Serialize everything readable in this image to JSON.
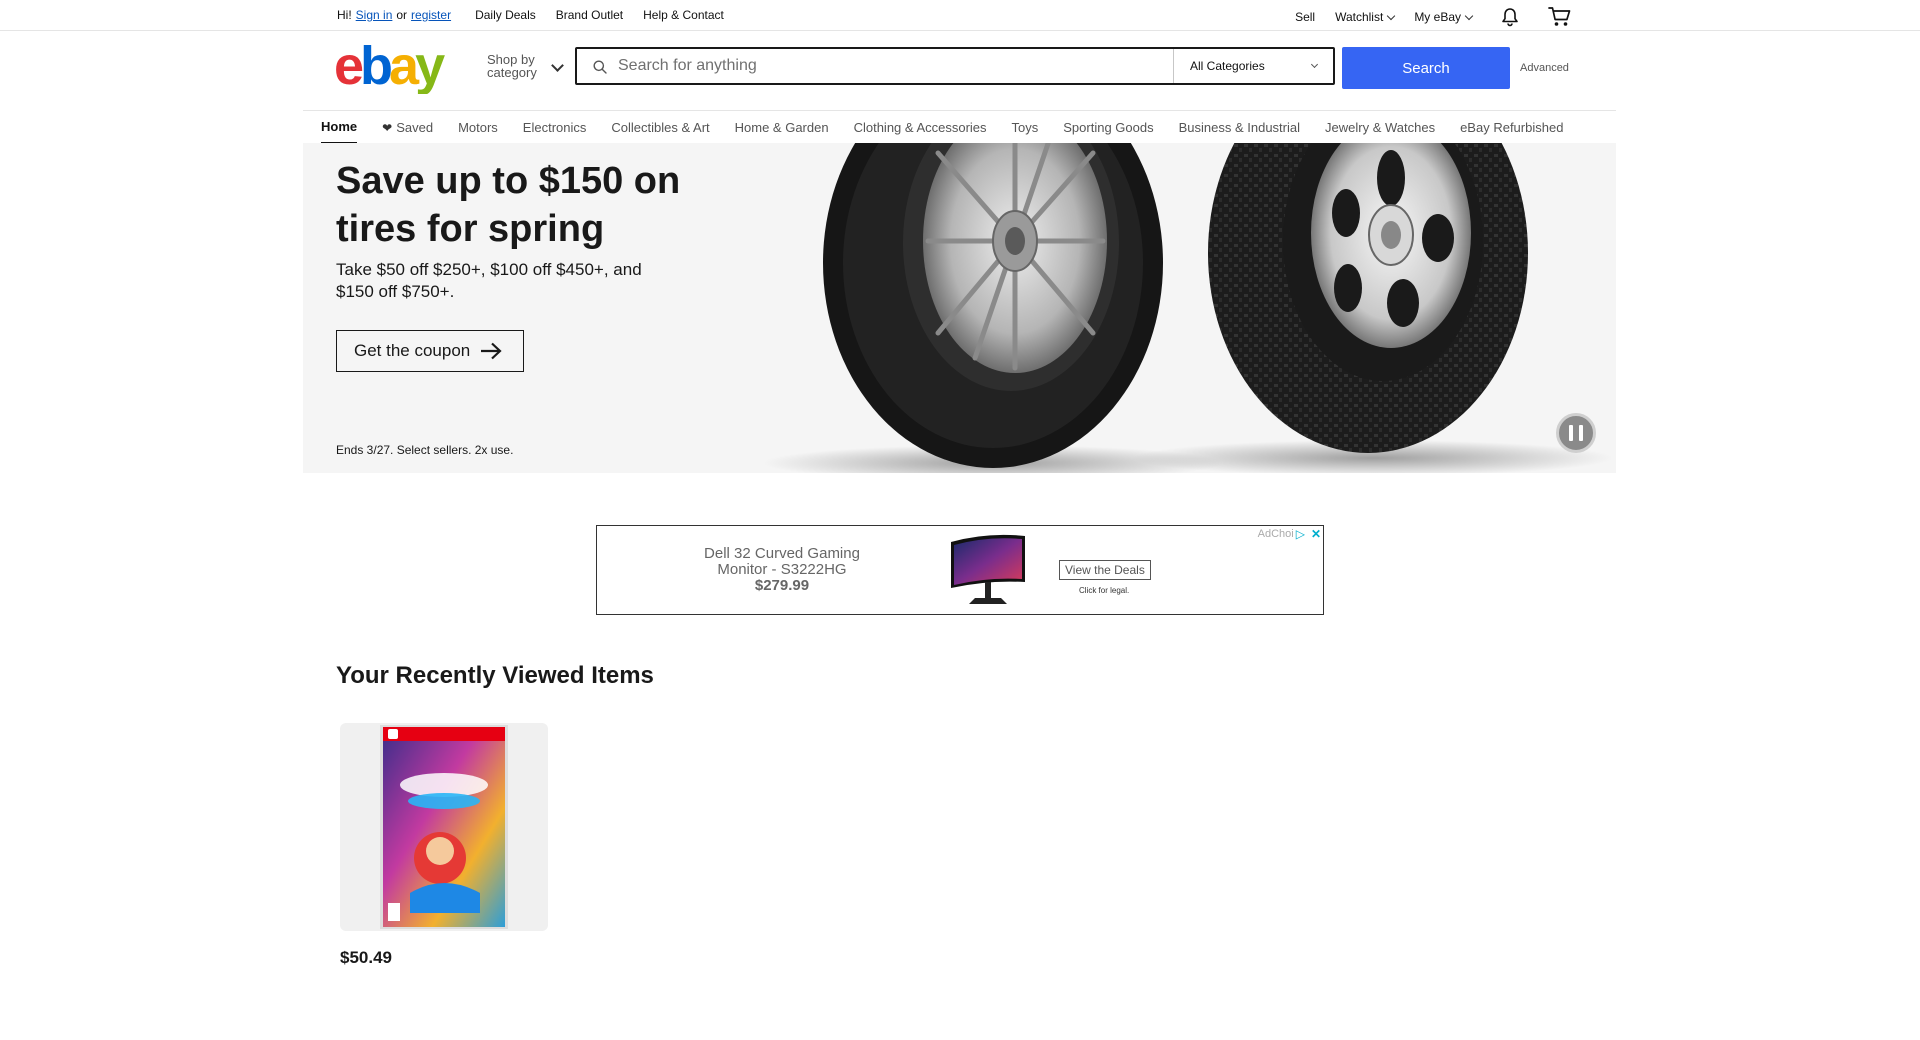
{
  "topbar": {
    "greeting": "Hi!",
    "sign_in": "Sign in",
    "or": "or",
    "register": "register",
    "links": [
      "Daily Deals",
      "Brand Outlet",
      "Help & Contact"
    ],
    "right": {
      "sell": "Sell",
      "watchlist": "Watchlist",
      "my_ebay": "My eBay"
    },
    "icons": {
      "notifications": "bell-icon",
      "cart": "cart-icon"
    }
  },
  "header": {
    "logo": "ebay",
    "shop_by_category": [
      "Shop by",
      "category"
    ],
    "search": {
      "placeholder": "Search for anything",
      "category": "All Categories",
      "button": "Search"
    },
    "advanced": "Advanced"
  },
  "nav": {
    "items": [
      "Home",
      "Saved",
      "Motors",
      "Electronics",
      "Collectibles & Art",
      "Home & Garden",
      "Clothing & Accessories",
      "Toys",
      "Sporting Goods",
      "Business & Industrial",
      "Jewelry & Watches",
      "eBay Refurbished"
    ],
    "active": "Home"
  },
  "hero": {
    "title": "Save up to $150 on tires for spring",
    "subtitle": "Take $50 off $250+, $100 off $450+, and $150 off $750+.",
    "cta": "Get the coupon",
    "fine_print": "Ends 3/27. Select sellers. 2x use."
  },
  "ad": {
    "product": "Dell 32 Curved Gaming Monitor - S3222HG",
    "price": "$279.99",
    "cta": "View the Deals",
    "legal": "Click for legal.",
    "adchoices": "AdChoi"
  },
  "recently_viewed": {
    "title": "Your Recently Viewed Items",
    "items": [
      {
        "price": "$50.49"
      }
    ]
  },
  "colors": {
    "brand_red": "#e53238",
    "brand_blue": "#0064d2",
    "brand_yellow": "#f5af02",
    "brand_green": "#86b817",
    "search_button": "#3665f3"
  }
}
